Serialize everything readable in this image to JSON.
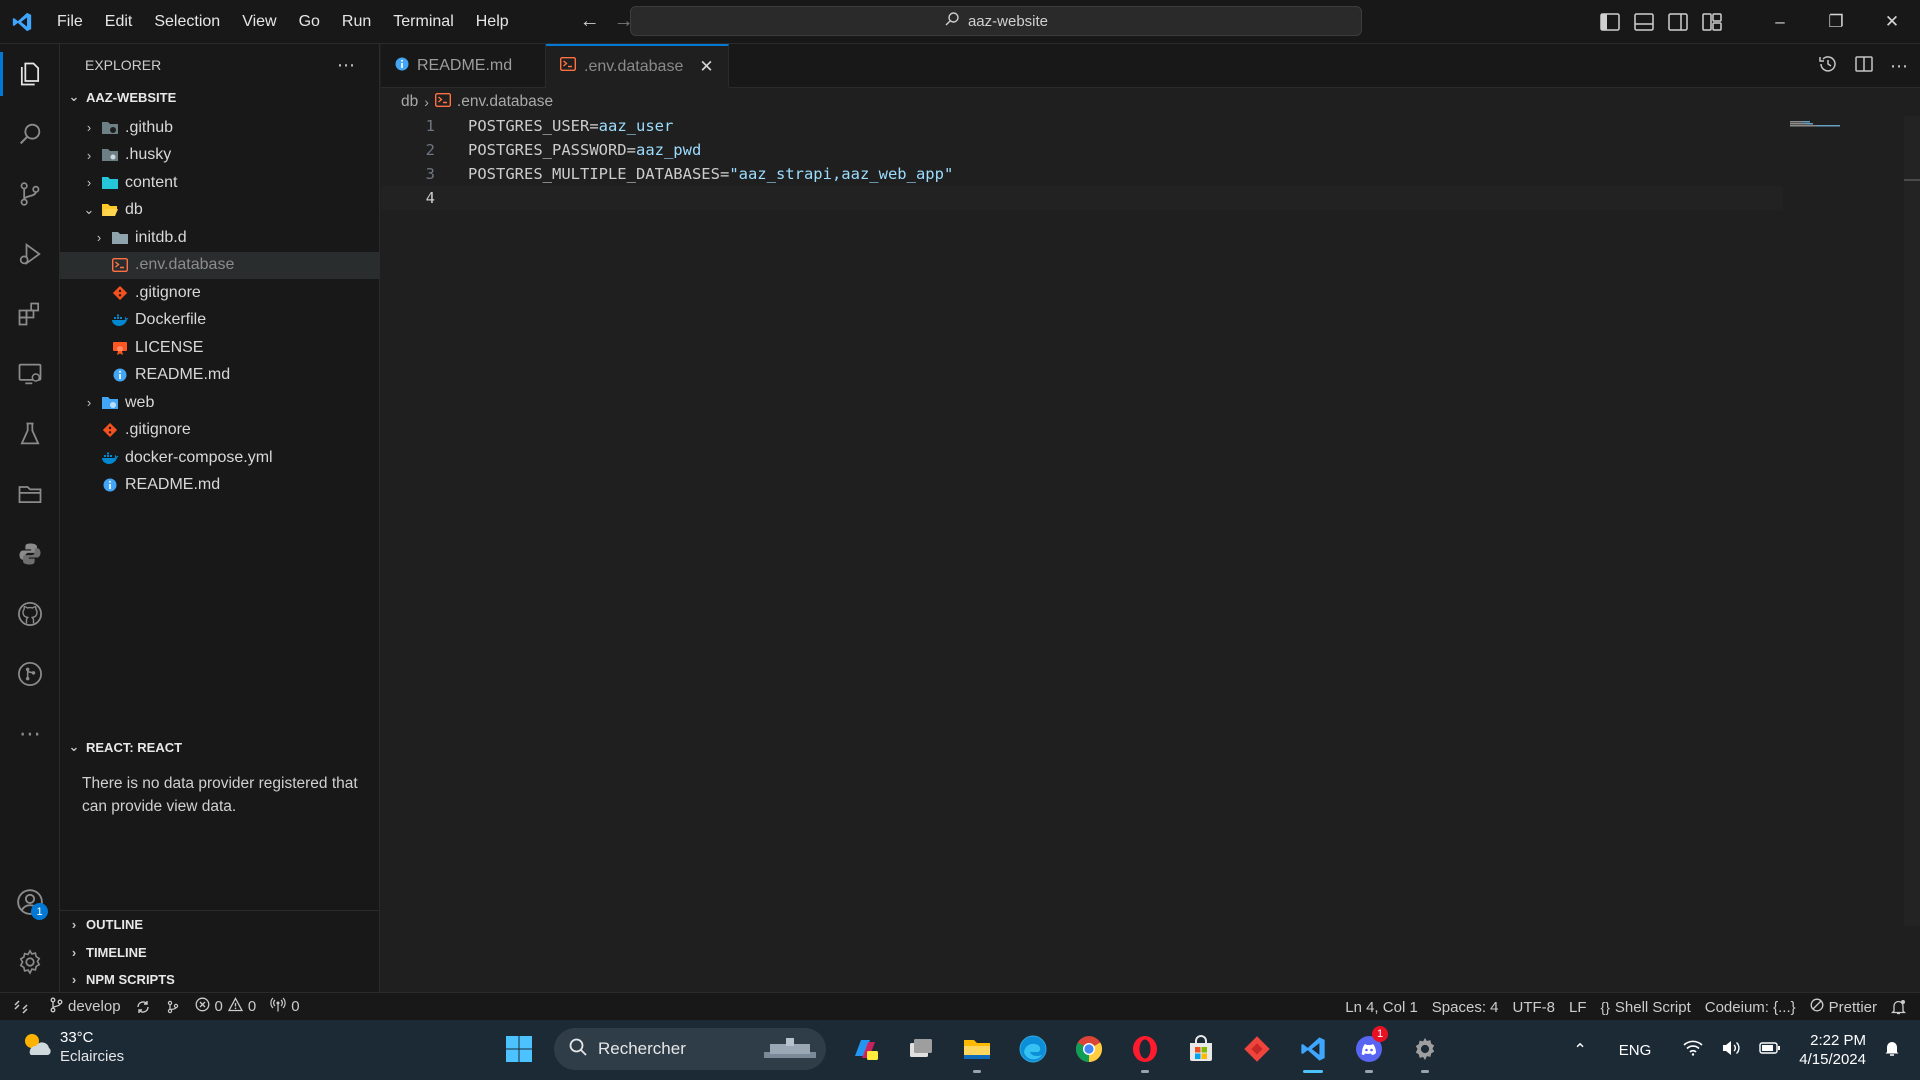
{
  "titlebar": {
    "menu": [
      "File",
      "Edit",
      "Selection",
      "View",
      "Go",
      "Run",
      "Terminal",
      "Help"
    ],
    "search_text": "aaz-website"
  },
  "explorer": {
    "header": "EXPLORER",
    "root": "AAZ-WEBSITE",
    "items": [
      {
        "label": ".github",
        "type": "folder",
        "depth": 1,
        "expanded": false
      },
      {
        "label": ".husky",
        "type": "folder",
        "depth": 1,
        "expanded": false
      },
      {
        "label": "content",
        "type": "folder",
        "depth": 1,
        "expanded": false
      },
      {
        "label": "db",
        "type": "folder",
        "depth": 1,
        "expanded": true
      },
      {
        "label": "initdb.d",
        "type": "folder",
        "depth": 2,
        "expanded": false
      },
      {
        "label": ".env.database",
        "type": "file",
        "depth": 2,
        "selected": true
      },
      {
        "label": ".gitignore",
        "type": "file",
        "depth": 2
      },
      {
        "label": "Dockerfile",
        "type": "file",
        "depth": 2
      },
      {
        "label": "LICENSE",
        "type": "file",
        "depth": 2
      },
      {
        "label": "README.md",
        "type": "file",
        "depth": 2
      },
      {
        "label": "web",
        "type": "folder",
        "depth": 1,
        "expanded": false
      },
      {
        "label": ".gitignore",
        "type": "file",
        "depth": 1
      },
      {
        "label": "docker-compose.yml",
        "type": "file",
        "depth": 1
      },
      {
        "label": "README.md",
        "type": "file",
        "depth": 1
      }
    ],
    "react_title": "REACT: REACT",
    "react_message": "There is no data provider registered that can provide view data.",
    "bottom_sections": [
      "OUTLINE",
      "TIMELINE",
      "NPM SCRIPTS"
    ]
  },
  "tabs": [
    {
      "label": "README.md",
      "active": false
    },
    {
      "label": ".env.database",
      "active": true
    }
  ],
  "breadcrumb": {
    "folder": "db",
    "file": ".env.database"
  },
  "code": {
    "lines": [
      {
        "num": "1",
        "key": "POSTGRES_USER",
        "op": "=",
        "value": "aaz_user"
      },
      {
        "num": "2",
        "key": "POSTGRES_PASSWORD",
        "op": "=",
        "value": "aaz_pwd"
      },
      {
        "num": "3",
        "key": "POSTGRES_MULTIPLE_DATABASES",
        "op": "=",
        "value": "\"aaz_strapi,aaz_web_app\""
      },
      {
        "num": "4",
        "key": "",
        "op": "",
        "value": ""
      }
    ]
  },
  "statusbar": {
    "branch": "develop",
    "errors": "0",
    "warnings": "0",
    "ports": "0",
    "position": "Ln 4, Col 1",
    "spaces": "Spaces: 4",
    "encoding": "UTF-8",
    "eol": "LF",
    "language": "Shell Script",
    "codeium": "Codeium: {...}",
    "prettier": "Prettier"
  },
  "taskbar": {
    "temperature": "33°C",
    "condition": "Eclaircies",
    "search_placeholder": "Rechercher",
    "language": "ENG",
    "time": "2:22 PM",
    "date": "4/15/2024",
    "discord_badge": "1"
  },
  "activity_badge": "1",
  "colors": {
    "accent": "#0078d4",
    "background": "#1f1f1f",
    "sidebar": "#181818",
    "taskbar": "#1c2a36"
  }
}
